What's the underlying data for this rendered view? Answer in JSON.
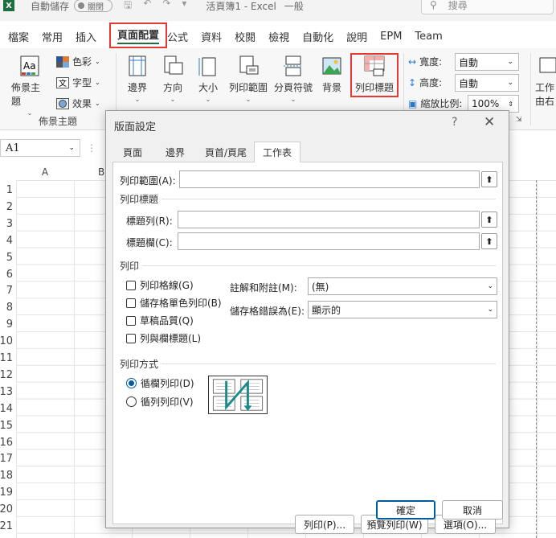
{
  "titlebar": {
    "logo": "X",
    "autosave_label": "自動儲存",
    "autosave_state": "關閉",
    "doc_title": "活頁簿1 - Excel",
    "sensitivity": "一般",
    "search_placeholder": "搜尋"
  },
  "ribbon_tabs": [
    "檔案",
    "常用",
    "插入",
    "頁面配置",
    "公式",
    "資料",
    "校閱",
    "檢視",
    "自動化",
    "說明",
    "EPM",
    "Team"
  ],
  "ribbon": {
    "themes_label": "佈景主題",
    "colors_label": "色彩",
    "fonts_label": "字型",
    "effects_label": "效果",
    "themes_group_label": "佈景主題",
    "margins_label": "邊界",
    "orientation_label": "方向",
    "size_label": "大小",
    "print_area_label": "列印範圍",
    "breaks_label": "分頁符號",
    "background_label": "背景",
    "print_titles_label": "列印標題",
    "width_label": "寬度:",
    "width_value": "自動",
    "height_label": "高度:",
    "height_value": "自動",
    "scale_label": "縮放比例:",
    "scale_value": "100%",
    "work_label_1": "工作",
    "work_label_2": "由右"
  },
  "formula_bar": {
    "name_box": "A1"
  },
  "grid": {
    "columns": [
      "A",
      "B"
    ],
    "rows": [
      "1",
      "2",
      "3",
      "4",
      "5",
      "6",
      "7",
      "8",
      "9",
      "10",
      "11",
      "12",
      "13",
      "14",
      "15",
      "16",
      "17",
      "18",
      "19",
      "20",
      "21"
    ]
  },
  "dialog": {
    "title": "版面設定",
    "help": "?",
    "tabs": [
      "頁面",
      "邊界",
      "頁首/頁尾",
      "工作表"
    ],
    "active_tab": "工作表",
    "print_area_label": "列印範圍(A):",
    "print_titles_section": "列印標題",
    "rows_to_repeat_label": "標題列(R):",
    "cols_to_repeat_label": "標題欄(C):",
    "print_section": "列印",
    "gridlines_label": "列印格線(G)",
    "black_white_label": "儲存格單色列印(B)",
    "draft_label": "草稿品質(Q)",
    "headings_label": "列與欄標題(L)",
    "comments_label": "註解和附註(M):",
    "comments_value": "(無)",
    "errors_label": "儲存格錯誤為(E):",
    "errors_value": "顯示的",
    "page_order_section": "列印方式",
    "down_then_over_label": "循欄列印(D)",
    "over_then_down_label": "循列列印(V)",
    "print_button": "列印(P)...",
    "preview_button": "預覽列印(W)",
    "options_button": "選項(O)...",
    "ok_button": "確定",
    "cancel_button": "取消"
  }
}
